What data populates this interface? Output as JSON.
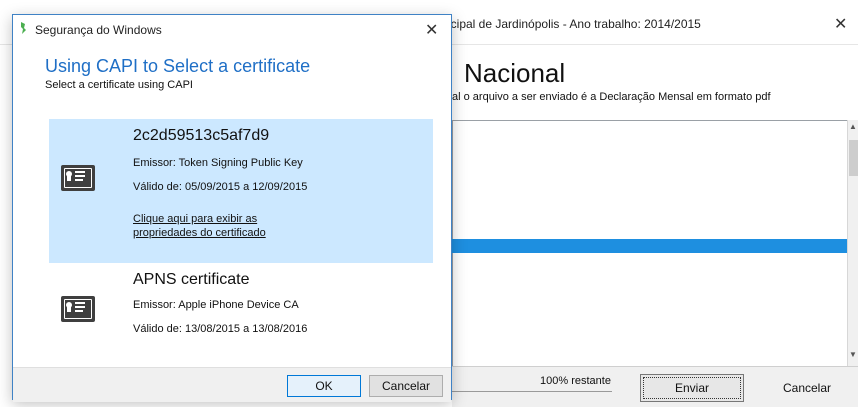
{
  "background_app": {
    "title": "icipal de Jardinópolis - Ano trabalho: 2014/2015",
    "close_label": "✕",
    "heading": "Nacional",
    "subtext": "al o arquivo a ser enviado é a Declaração Mensal em formato pdf",
    "progress_percent": 100,
    "status_text": "100% restante",
    "send_label": "Enviar",
    "cancel_label": "Cancelar",
    "colors": {
      "progress": "#1e8fe0"
    }
  },
  "dialog": {
    "window_title": "Segurança do Windows",
    "close_label": "✕",
    "heading": "Using CAPI to Select a certificate",
    "subheading": "Select a certificate using CAPI",
    "certificates": [
      {
        "name": "2c2d59513c5af7d9",
        "issuer": "Emissor: Token Signing Public Key",
        "validity": "Válido de: 05/09/2015 a 12/09/2015",
        "link_line1": "Clique aqui para exibir as",
        "link_line2": "propriedades do certificado",
        "selected": true,
        "icon": "certificate-icon"
      },
      {
        "name": "APNS certificate",
        "issuer": "Emissor: Apple iPhone Device CA",
        "validity": "Válido de: 13/08/2015 a 13/08/2016",
        "selected": false,
        "icon": "certificate-icon"
      }
    ],
    "ok_label": "OK",
    "cancel_label": "Cancelar",
    "colors": {
      "heading": "#1f6fc6",
      "selected_row": "#cce8ff",
      "border": "#3f82c5"
    }
  }
}
